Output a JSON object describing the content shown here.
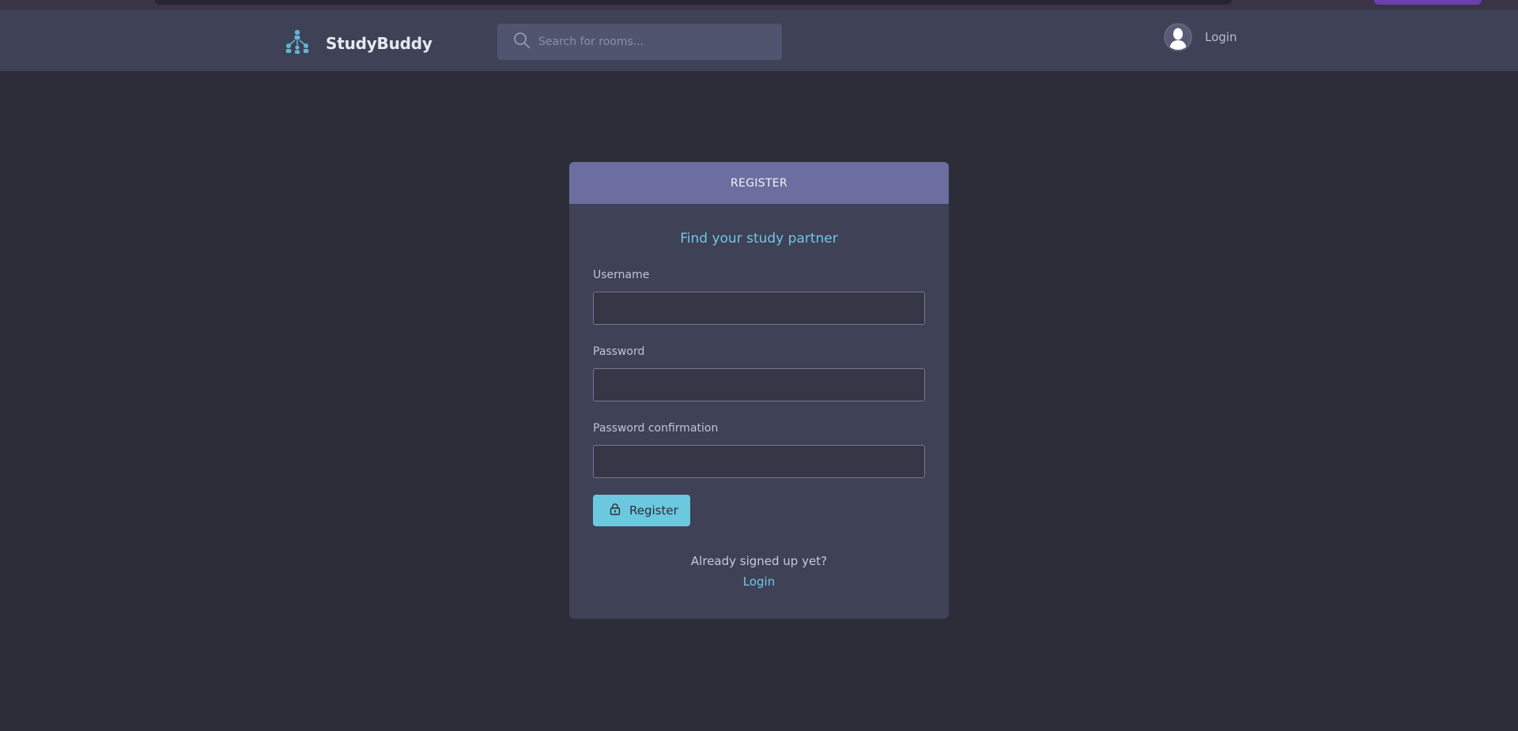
{
  "header": {
    "brand": "StudyBuddy",
    "search_placeholder": "Search for rooms...",
    "login_label": "Login"
  },
  "card": {
    "title": "REGISTER",
    "tagline": "Find your study partner",
    "fields": [
      {
        "label": "Username",
        "value": ""
      },
      {
        "label": "Password",
        "value": ""
      },
      {
        "label": "Password confirmation",
        "value": ""
      }
    ],
    "submit_label": "Register",
    "already_text": "Already signed up yet?",
    "login_link": "Login"
  },
  "colors": {
    "background": "#2d2d39",
    "header": "#3f4156",
    "card_header": "#6b6e9e",
    "accent": "#6fc8e6",
    "button": "#6cc8de"
  },
  "icons": {
    "logo": "people-network-icon",
    "search": "search-icon",
    "avatar": "user-avatar-icon",
    "register": "lock-icon"
  }
}
